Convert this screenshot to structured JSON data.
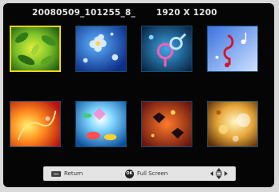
{
  "header": {
    "filename": "20080509_101255_8_",
    "resolution": "1920 X 1200"
  },
  "thumbnails": [
    {
      "name": "thumbnail-green-leaves",
      "selected": true,
      "theme": "green leaves"
    },
    {
      "name": "thumbnail-blue-flowers",
      "selected": false,
      "theme": "blue flowers"
    },
    {
      "name": "thumbnail-gender-symbols",
      "selected": false,
      "theme": "gender symbols"
    },
    {
      "name": "thumbnail-music-notes",
      "selected": false,
      "theme": "music notes"
    },
    {
      "name": "thumbnail-fire-swirl",
      "selected": false,
      "theme": "orange fire"
    },
    {
      "name": "thumbnail-colorful-fish",
      "selected": false,
      "theme": "colorful fish"
    },
    {
      "name": "thumbnail-butterflies",
      "selected": false,
      "theme": "butterflies"
    },
    {
      "name": "thumbnail-golden-bubbles",
      "selected": false,
      "theme": "golden bubbles"
    }
  ],
  "footer": {
    "return_label": "Return",
    "ok_label": "OK",
    "fullscreen_label": "Full Screen",
    "navigate_icon": "four-way-arrows-icon"
  }
}
